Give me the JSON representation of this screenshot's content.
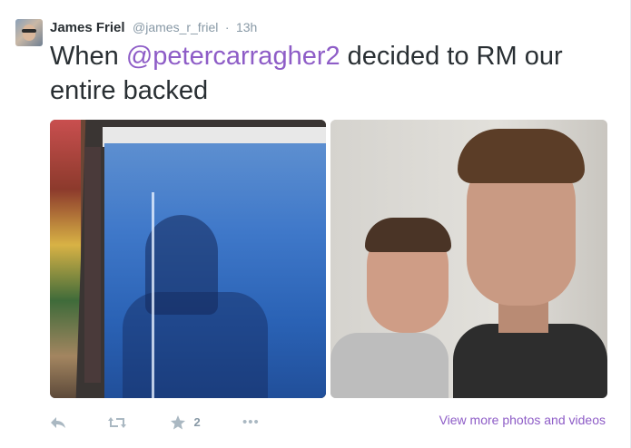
{
  "tweet": {
    "name": "James Friel",
    "handle": "@james_r_friel",
    "separator": "·",
    "time": "13h",
    "text_before": "When ",
    "mention": "@petercarragher2",
    "text_after": "  decided to RM our entire backed"
  },
  "actions": {
    "favorite_count": "2",
    "more_label": "•••"
  },
  "media_link": "View more photos and videos",
  "colors": {
    "link": "#8e5dc7",
    "text": "#292f33",
    "muted": "#8899a6",
    "icon": "#aab8c2"
  },
  "icons": [
    "reply-icon",
    "retweet-icon",
    "favorite-star-icon",
    "more-icon"
  ]
}
